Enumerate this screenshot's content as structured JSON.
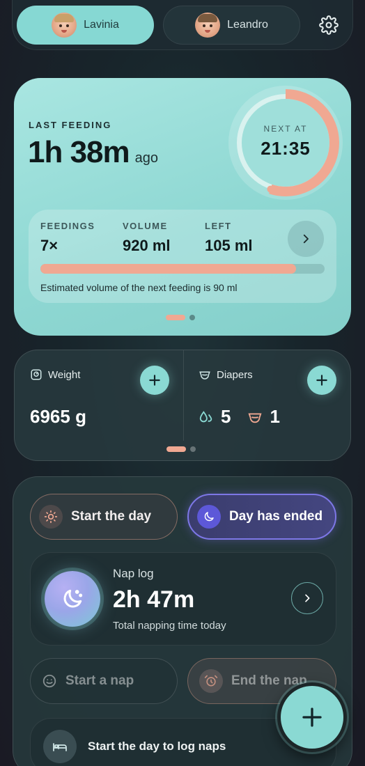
{
  "profiles": [
    {
      "name": "Lavinia",
      "active": true
    },
    {
      "name": "Leandro",
      "active": false
    }
  ],
  "icons": {
    "settings": "gear-icon",
    "arrow": "chevron-right-icon",
    "plus": "plus-icon",
    "sun": "sun-icon",
    "moon": "moon-icon"
  },
  "colors": {
    "accent": "#8ad9d3",
    "peach": "#f0a892",
    "purple": "#7d77e6"
  },
  "feeding": {
    "last_label": "LAST FEEDING",
    "last_value": "1h 38m",
    "last_suffix": "ago",
    "next_label": "NEXT AT",
    "next_time": "21:35",
    "ring_progress": 0.55,
    "stats": [
      {
        "label": "FEEDINGS",
        "value": "7×"
      },
      {
        "label": "VOLUME",
        "value": "920 ml"
      },
      {
        "label": "LEFT",
        "value": "105 ml"
      }
    ],
    "volume_progress": 0.9,
    "estimate_text": "Estimated volume of the next feeding is 90 ml"
  },
  "weight": {
    "title": "Weight",
    "value": "6965 g"
  },
  "diapers": {
    "title": "Diapers",
    "wet": "5",
    "dirty": "1"
  },
  "day": {
    "start_label": "Start the day",
    "ended_label": "Day has ended"
  },
  "nap": {
    "title": "Nap log",
    "value": "2h 47m",
    "subtitle": "Total napping time today",
    "start_label": "Start a nap",
    "end_label": "End the nap",
    "prompt": "Start the day to log naps"
  }
}
